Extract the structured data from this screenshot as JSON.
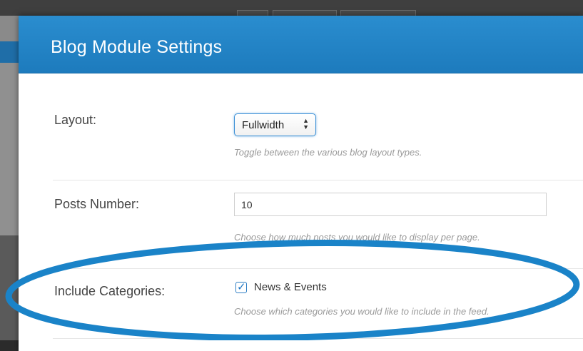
{
  "modal": {
    "title": "Blog Module Settings"
  },
  "fields": {
    "layout": {
      "label": "Layout:",
      "value": "Fullwidth",
      "hint": "Toggle between the various blog layout types."
    },
    "posts_number": {
      "label": "Posts Number:",
      "value": "10",
      "hint": "Choose how much posts you would like to display per page."
    },
    "include_categories": {
      "label": "Include Categories:",
      "option": "News & Events",
      "checked": true,
      "hint": "Choose which categories you would like to include in the feed."
    }
  },
  "colors": {
    "header": "#1d7bbd",
    "annotation": "#1a83c8"
  },
  "icons": {
    "select_arrows": "up-down-arrows-icon",
    "checkbox_tick": "checkmark-icon"
  }
}
